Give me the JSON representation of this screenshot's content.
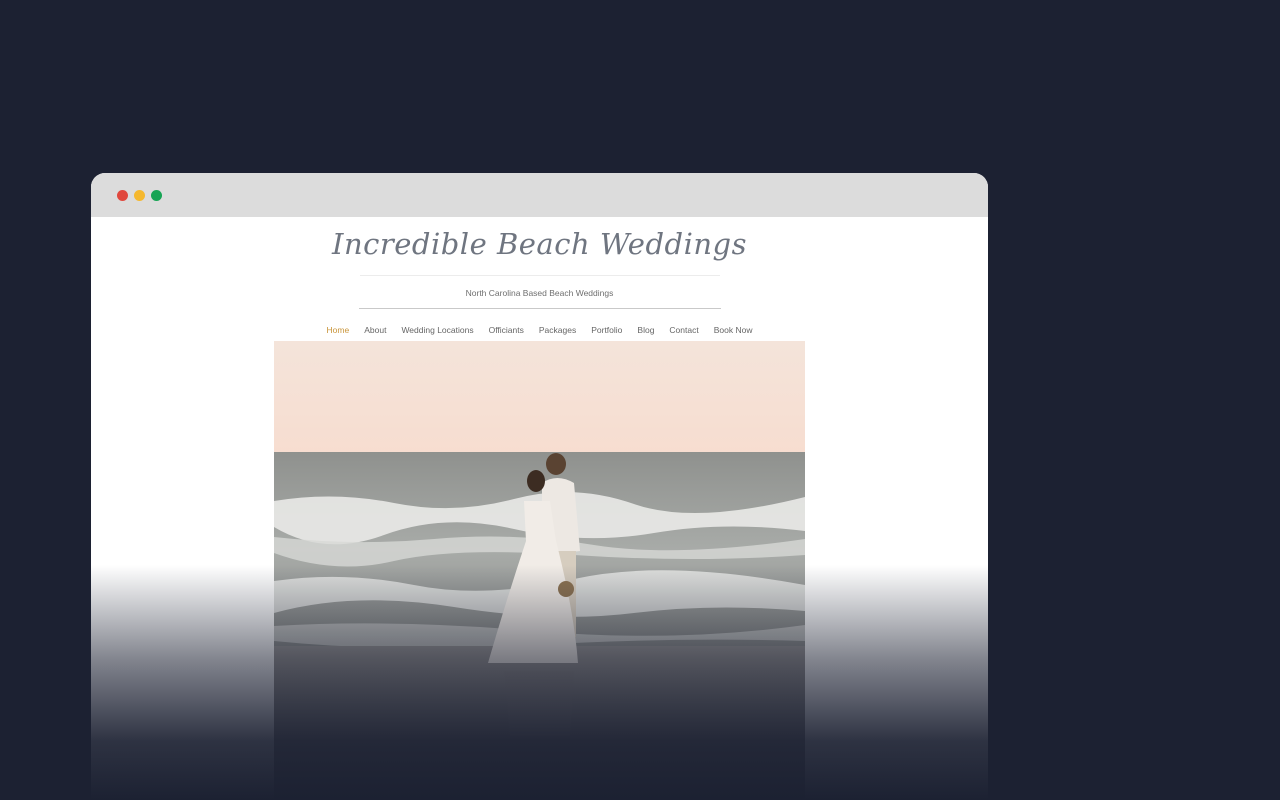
{
  "browser": {
    "controls": [
      {
        "name": "close",
        "color": "#e0483e"
      },
      {
        "name": "minimize",
        "color": "#f5b82e"
      },
      {
        "name": "maximize",
        "color": "#17a454"
      }
    ]
  },
  "site": {
    "title": "Incredible Beach Weddings",
    "tagline": "North Carolina Based Beach Weddings"
  },
  "nav": {
    "active_color": "#c9953a",
    "items": [
      {
        "label": "Home",
        "active": true
      },
      {
        "label": "About"
      },
      {
        "label": "Wedding Locations"
      },
      {
        "label": "Officiants"
      },
      {
        "label": "Packages"
      },
      {
        "label": "Portfolio"
      },
      {
        "label": "Blog"
      },
      {
        "label": "Contact"
      },
      {
        "label": "Book Now"
      }
    ]
  }
}
